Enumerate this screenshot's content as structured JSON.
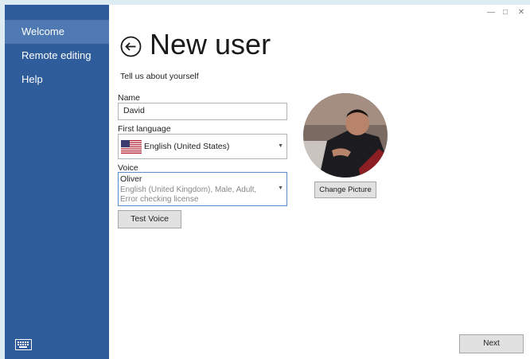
{
  "sidebar": {
    "items": [
      {
        "label": "Welcome",
        "active": true
      },
      {
        "label": "Remote editing",
        "active": false
      },
      {
        "label": "Help",
        "active": false
      }
    ],
    "keyboard_icon": "keyboard-icon"
  },
  "window_controls": {
    "minimize": "minimize-icon",
    "maximize": "maximize-icon",
    "close": "close-icon"
  },
  "header": {
    "back_icon": "back-arrow-icon",
    "title": "New user",
    "subtitle": "Tell us about yourself"
  },
  "form": {
    "name": {
      "label": "Name",
      "value": "David"
    },
    "first_language": {
      "label": "First language",
      "value": "English (United States)",
      "flag_icon": "us-flag-icon"
    },
    "voice": {
      "label": "Voice",
      "name": "Oliver",
      "description": "English (United Kingdom), Male, Adult, Error checking license"
    },
    "test_voice_label": "Test Voice"
  },
  "picture": {
    "change_label": "Change Picture"
  },
  "footer": {
    "next_label": "Next"
  },
  "colors": {
    "sidebar": "#2f5d9b",
    "sidebar_active": "#4e79b2",
    "focus_border": "#5b8fcc"
  }
}
